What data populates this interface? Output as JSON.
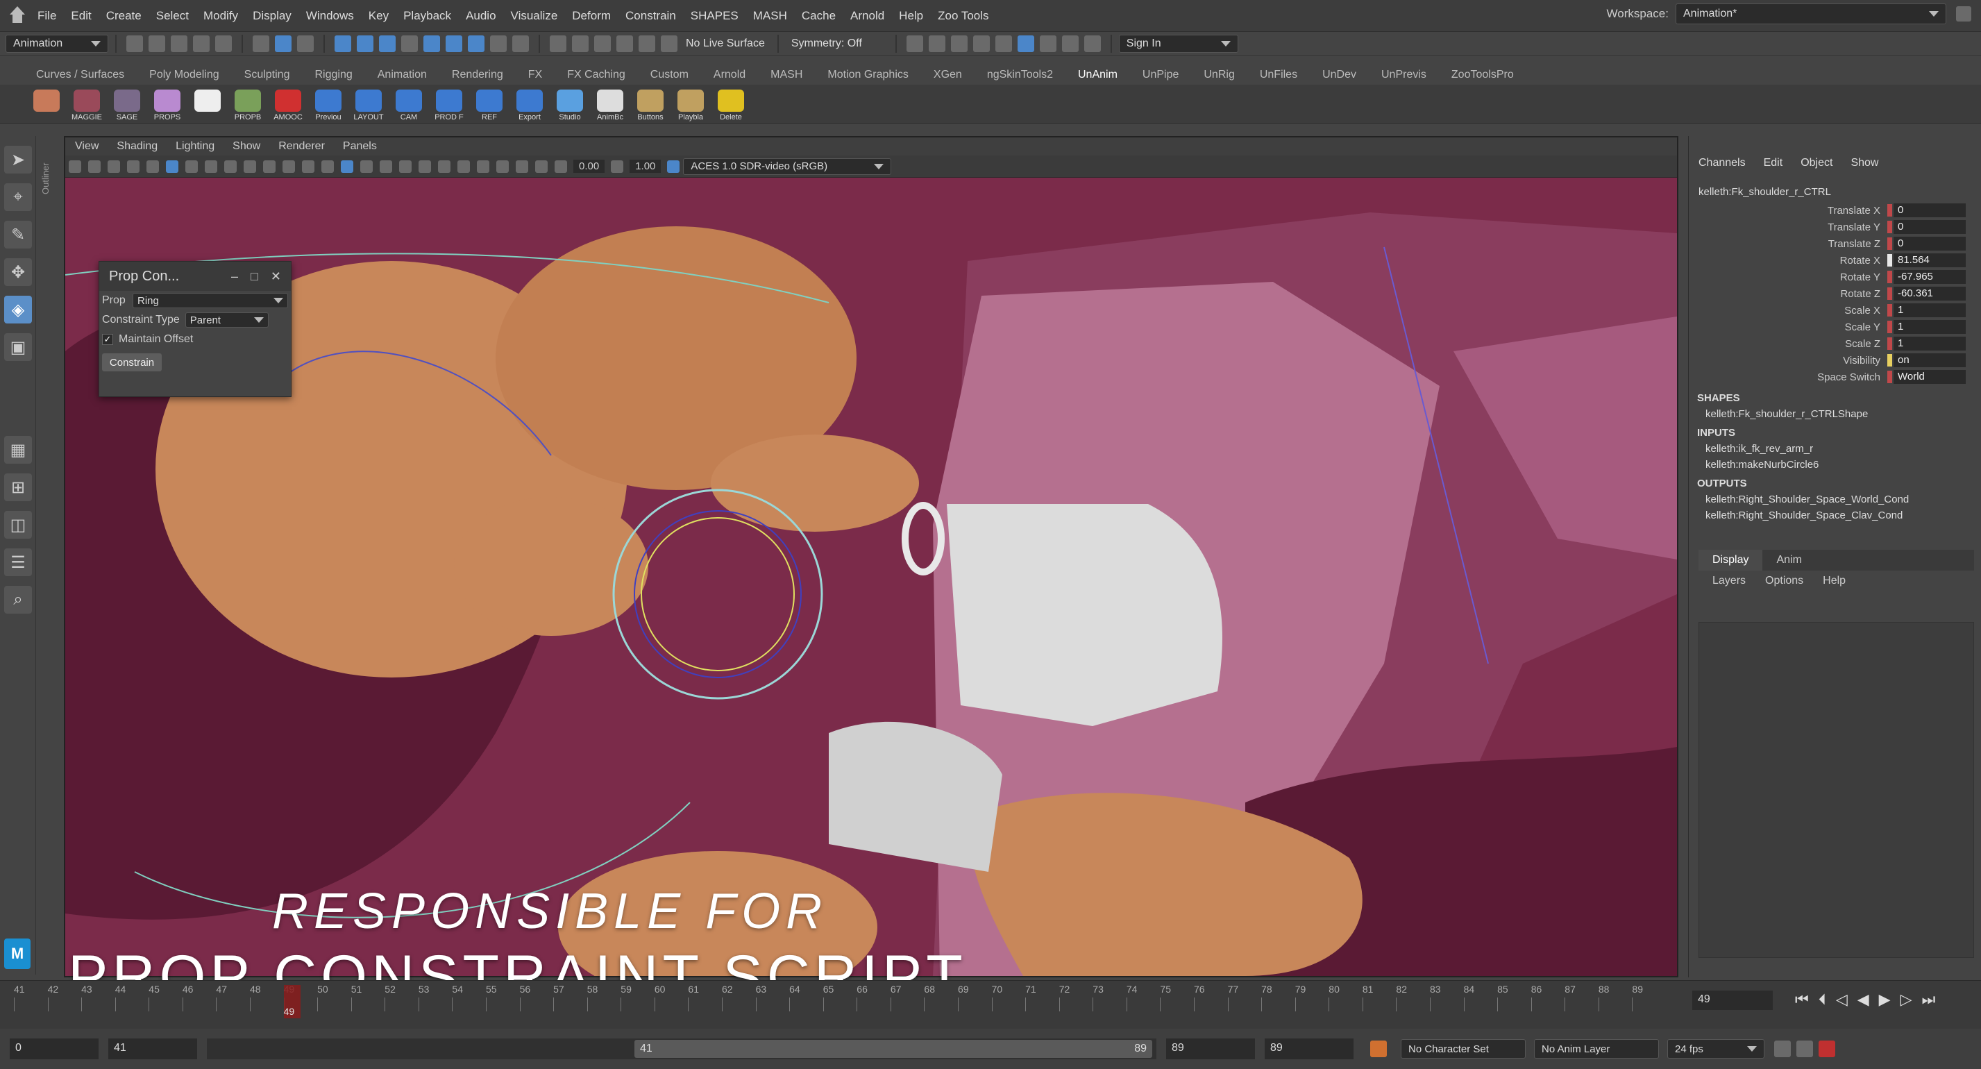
{
  "menubar": {
    "items": [
      "File",
      "Edit",
      "Create",
      "Select",
      "Modify",
      "Display",
      "Windows",
      "Key",
      "Playback",
      "Audio",
      "Visualize",
      "Deform",
      "Constrain",
      "SHAPES",
      "MASH",
      "Cache",
      "Arnold",
      "Help",
      "Zoo Tools"
    ],
    "workspace_label": "Workspace:",
    "workspace_value": "Animation*"
  },
  "statusline": {
    "menuset": "Animation",
    "live_surface": "No Live Surface",
    "symmetry": "Symmetry: Off",
    "sign_in": "Sign In"
  },
  "shelf_tabs": [
    "Curves / Surfaces",
    "Poly Modeling",
    "Sculpting",
    "Rigging",
    "Animation",
    "Rendering",
    "FX",
    "FX Caching",
    "Custom",
    "Arnold",
    "MASH",
    "Motion Graphics",
    "XGen",
    "ngSkinTools2",
    "UnAnim",
    "UnPipe",
    "UnRig",
    "UnFiles",
    "UnDev",
    "UnPrevis",
    "ZooToolsPro"
  ],
  "shelf_active": "UnAnim",
  "shelf_buttons": [
    {
      "label": "",
      "color": "#c87a5a"
    },
    {
      "label": "MAGGIE",
      "color": "#9a4a5a"
    },
    {
      "label": "SAGE",
      "color": "#7a6a8a"
    },
    {
      "label": "PROPS",
      "color": "#b98ad0"
    },
    {
      "label": "",
      "color": "#eeeeee"
    },
    {
      "label": "PROPB",
      "color": "#7aa05a"
    },
    {
      "label": "AMOOC",
      "color": "#d03030"
    },
    {
      "label": "Previou",
      "color": "#3d7ad0"
    },
    {
      "label": "LAYOUT",
      "color": "#3d7ad0"
    },
    {
      "label": "CAM",
      "color": "#3d7ad0"
    },
    {
      "label": "PROD F",
      "color": "#3d7ad0"
    },
    {
      "label": "REF",
      "color": "#3d7ad0"
    },
    {
      "label": "Export",
      "color": "#3d7ad0"
    },
    {
      "label": "Studio",
      "color": "#5aa0e0"
    },
    {
      "label": "AnimBc",
      "color": "#dddddd"
    },
    {
      "label": "Buttons",
      "color": "#c0a060"
    },
    {
      "label": "Playbla",
      "color": "#c0a060"
    },
    {
      "label": "Delete",
      "color": "#e0c020"
    }
  ],
  "viewport": {
    "menu": [
      "View",
      "Shading",
      "Lighting",
      "Show",
      "Renderer",
      "Panels"
    ],
    "exposure": "0.00",
    "gamma": "1.00",
    "colorspace": "ACES 1.0 SDR-video (sRGB)"
  },
  "outliner_label": "Outliner",
  "prop_window": {
    "title": "Prop Con...",
    "prop_label": "Prop",
    "prop_value": "Ring",
    "constraint_label": "Constraint Type",
    "constraint_value": "Parent",
    "maintain_offset": "Maintain Offset",
    "button": "Constrain"
  },
  "caption": {
    "line1": "RESPONSIBLE FOR",
    "line2": "PROP CONSTRAINT SCRIPT"
  },
  "channel_box": {
    "tabs": [
      "Channels",
      "Edit",
      "Object",
      "Show"
    ],
    "object": "kelleth:Fk_shoulder_r_CTRL",
    "channels": [
      {
        "name": "Translate X",
        "value": "0",
        "color": "#c0484a"
      },
      {
        "name": "Translate Y",
        "value": "0",
        "color": "#c0484a"
      },
      {
        "name": "Translate Z",
        "value": "0",
        "color": "#c0484a"
      },
      {
        "name": "Rotate X",
        "value": "81.564",
        "color": "#e8e8e8"
      },
      {
        "name": "Rotate Y",
        "value": "-67.965",
        "color": "#c0484a"
      },
      {
        "name": "Rotate Z",
        "value": "-60.361",
        "color": "#c0484a"
      },
      {
        "name": "Scale X",
        "value": "1",
        "color": "#c0484a"
      },
      {
        "name": "Scale Y",
        "value": "1",
        "color": "#c0484a"
      },
      {
        "name": "Scale Z",
        "value": "1",
        "color": "#c0484a"
      },
      {
        "name": "Visibility",
        "value": "on",
        "color": "#e8d060"
      },
      {
        "name": "Space Switch",
        "value": "World",
        "color": "#c0484a"
      }
    ],
    "shapes_header": "SHAPES",
    "shapes": [
      "kelleth:Fk_shoulder_r_CTRLShape"
    ],
    "inputs_header": "INPUTS",
    "inputs": [
      "kelleth:ik_fk_rev_arm_r",
      "kelleth:makeNurbCircle6"
    ],
    "outputs_header": "OUTPUTS",
    "outputs": [
      "kelleth:Right_Shoulder_Space_World_Cond",
      "kelleth:Right_Shoulder_Space_Clav_Cond"
    ]
  },
  "layers": {
    "tabs": [
      "Display",
      "Anim"
    ],
    "menu": [
      "Layers",
      "Options",
      "Help"
    ]
  },
  "timeline": {
    "ticks": [
      "41",
      "42",
      "43",
      "44",
      "45",
      "46",
      "47",
      "48",
      "49",
      "50",
      "51",
      "52",
      "53",
      "54",
      "55",
      "56",
      "57",
      "58",
      "59",
      "60",
      "61",
      "62",
      "63",
      "64",
      "65",
      "66",
      "67",
      "68",
      "69",
      "70",
      "71",
      "72",
      "73",
      "74",
      "75",
      "76",
      "77",
      "78",
      "79",
      "80",
      "81",
      "82",
      "83",
      "84",
      "85",
      "86",
      "87",
      "88",
      "89"
    ],
    "current_frame": "49",
    "frame_field": "49"
  },
  "range": {
    "start": "0",
    "playback_start": "41",
    "slider_start": "41",
    "slider_end": "89",
    "playback_end": "89",
    "end": "89",
    "character_set": "No Character Set",
    "anim_layer": "No Anim Layer",
    "fps": "24 fps"
  },
  "colors": {
    "accent": "#4b86c9",
    "viewport_bg": "#7a2a48",
    "skin": "#c8875a"
  }
}
